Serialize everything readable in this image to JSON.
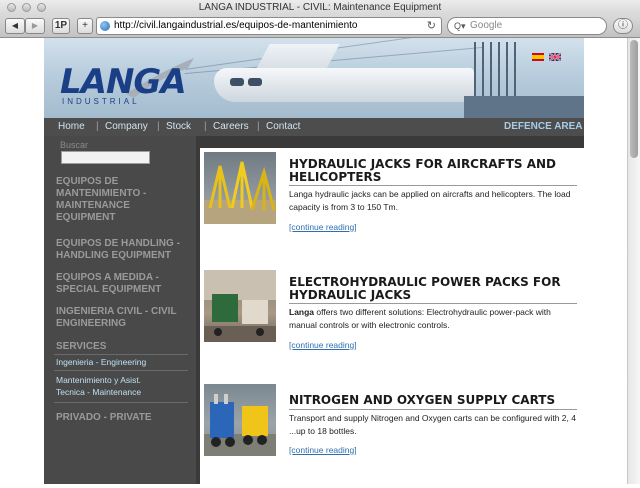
{
  "browser": {
    "window_title": "LANGA INDUSTRIAL - CIVIL: Maintenance Equipment",
    "url": "http://civil.langaindustrial.es/equipos-de-mantenimiento",
    "search_placeholder": "Google",
    "back_glyph": "◀",
    "forward_glyph": "▶",
    "onepassword_label": "1P",
    "add_glyph": "+",
    "reload_glyph": "↻",
    "search_glyph": "Q▾",
    "info_glyph": "ⓘ"
  },
  "site": {
    "logo_text": "LANGA",
    "logo_subtext": "INDUSTRIAL",
    "nav": {
      "home": "Home",
      "company": "Company",
      "stock": "Stock",
      "careers": "Careers",
      "contact": "Contact",
      "defence": "DEFENCE AREA"
    },
    "sidebar": {
      "search_label": "Buscar",
      "categories": [
        "EQUIPOS DE MANTENIMIENTO - MAINTENANCE EQUIPMENT",
        "EQUIPOS DE HANDLING - HANDLING EQUIPMENT",
        "EQUIPOS A MEDIDA - SPECIAL EQUIPMENT",
        "INGENIERIA CIVIL - CIVIL ENGINEERING"
      ],
      "services_heading": "SERVICES",
      "services": [
        "Ingenieria - Engineering",
        "Mantenimiento y Asist. Tecnica - Maintenance"
      ],
      "private": "PRIVADO - PRIVATE"
    },
    "articles": [
      {
        "title": "HYDRAULIC JACKS FOR AIRCRAFTS AND HELICOPTERS",
        "body": "Langa hydraulic jacks can be applied on aircrafts and helicopters. The load capacity is from 3 to 150 Tm.",
        "link": "[continue reading]"
      },
      {
        "title": "ELECTROHYDRAULIC POWER PACKS FOR HYDRAULIC JACKS",
        "body_bold": "Langa",
        "body": " offers two different solutions: Electrohydraulic power-pack with manual controls or with electronic controls.",
        "link": "[continue reading]"
      },
      {
        "title": "NITROGEN AND OXYGEN SUPPLY CARTS",
        "body": "Transport and supply Nitrogen and Oxygen carts can be configured with 2, 4 ...up to 18 bottles.",
        "link": "[continue reading]"
      }
    ]
  },
  "colors": {
    "nav_bg": "#4d4d4d",
    "sidebar_bg": "#494949",
    "link_blue": "#2f6fb0",
    "logo_blue": "#1b3f86"
  }
}
